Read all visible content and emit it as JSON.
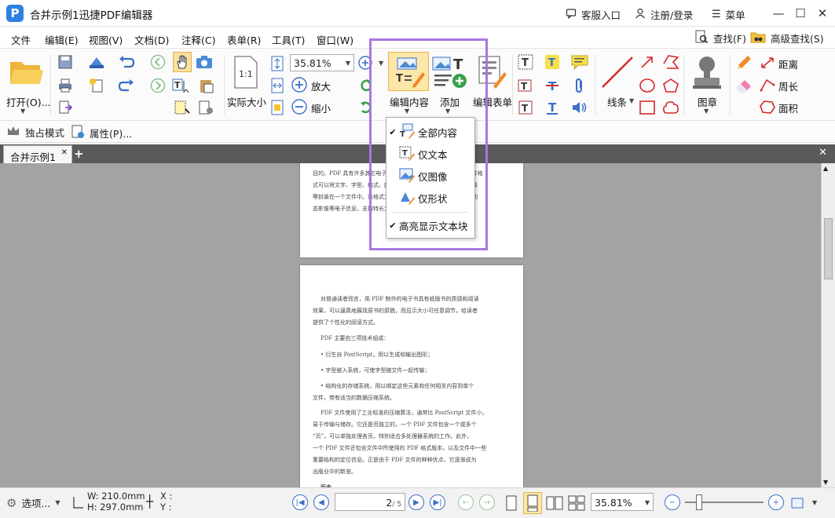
{
  "titlebar": {
    "app_title": "合并示例1迅捷PDF编辑器",
    "service_link": "客服入口",
    "login_link": "注册/登录",
    "menu_link": "菜单"
  },
  "menubar": {
    "items": [
      "文件",
      "编辑(E)",
      "视图(V)",
      "文档(D)",
      "注释(C)",
      "表单(R)",
      "工具(T)",
      "窗口(W)"
    ],
    "find_label": "查找(F)",
    "advanced_find_label": "高级查找(S)"
  },
  "ribbon": {
    "open_label": "打开(O)...",
    "actual_size_label": "实际大小",
    "actual_size_icon_text": "1:1",
    "zoom_value": "35.81%",
    "zoom_in_label": "放大",
    "zoom_out_label": "缩小",
    "edit_content_label": "编辑内容",
    "add_label": "添加",
    "edit_form_label": "编辑表单",
    "line_label": "线条",
    "stamp_label": "图章",
    "distance_label": "距离",
    "perimeter_label": "周长",
    "area_label": "面积"
  },
  "secondbar": {
    "exclusive_mode_label": "独占模式",
    "properties_label": "属性(P)..."
  },
  "tabs": {
    "doc_tab_label": "合并示例1",
    "add_tab": "+",
    "close_all": "✕"
  },
  "dropdown": {
    "items": [
      "全部内容",
      "仅文本",
      "仅图像",
      "仅形状"
    ],
    "highlight_label": "高亮显示文本块"
  },
  "page_top": {
    "lines": [
      "目的。PDF 具有许多其它电子文档格式无法相比的优点。PDF 文件格",
      "式可以将文字、字型、格式、颜色及独立于设备和分辨率的图形图像",
      "等封装在一个文件中。该格式文件还可以包含超文本链接、声音和动",
      "态影像等电子信息，支持特长文件，集成度和安全可靠性都较高。"
    ]
  },
  "page_main": {
    "paragraphs": [
      "对普通读者而言，用 PDF 制作的电子书具有纸版书的质感和阅读",
      "效果，可以逼真地展现原书的原貌，而显示大小可任意调节，给读者",
      "提供了个性化的阅读方式。",
      "PDF 主要由三项技术组成：",
      "• 衍生自 PostScript，用以生成和输出图形；",
      "• 字型嵌入系统，可使字型随文件一起传输；",
      "• 结构化的存储系统，用以绑定这些元素和任何相关内容到单个",
      "文件，带有适当的数据压缩系统。",
      "PDF 文件使用了工业标准的压缩算法，通常比 PostScript 文件小，",
      "易于传输与储存。它还是页独立的，一个 PDF 文件包含一个或多个",
      "“页”，可以单独处理各页，特别适合多处理器系统的工作。此外，",
      "一个 PDF 文件还包含文件中所使用的 PDF 格式版本，以及文件中一些",
      "重要结构的定位信息。正是由于 PDF 文件的种种优点，它逐渐成为",
      "出版业中的新宠。",
      "历史"
    ]
  },
  "statusbar": {
    "options_label": "选项...",
    "width_text": "W: 210.0mm",
    "height_text": "H: 297.0mm",
    "x_text": "X :",
    "y_text": "Y :",
    "page_current": "2",
    "page_total": "/ 5",
    "zoom_value": "35.81%"
  },
  "colors": {
    "accent_blue": "#3a6fc4",
    "highlight_purple": "#a877e0",
    "workspace_gray": "#a3a3a3"
  }
}
